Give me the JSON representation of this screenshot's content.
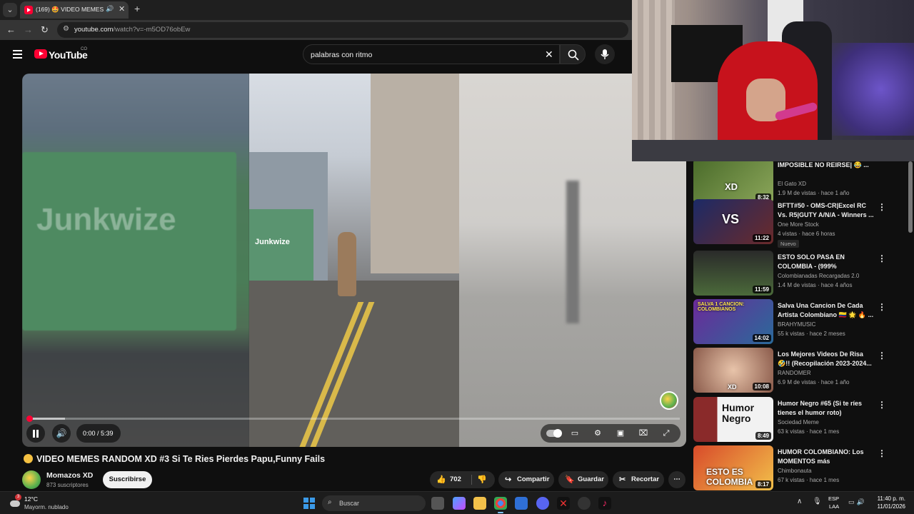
{
  "browser": {
    "tab_title": "(169) 🤩 VIDEO MEMES RA",
    "url_host": "youtube.com",
    "url_path": "/watch?v=-m5OD76obEw",
    "new_tab": "+"
  },
  "youtube": {
    "logo_text": "YouTube",
    "region": "CO",
    "search_value": "palabras con ritmo"
  },
  "player": {
    "time": "0:00 / 5:39",
    "progress_fraction": 0.0,
    "truck_text_left": "Junkwize",
    "truck_text_center": "Junkwize"
  },
  "video": {
    "title": "VIDEO MEMES RANDOM XD #3 Si Te Ries Pierdes Papu,Funny Fails",
    "channel": "Momazos XD",
    "subscribers": "873 suscriptores",
    "subscribe_label": "Suscribirse",
    "likes": "702",
    "share_label": "Compartir",
    "save_label": "Guardar",
    "clip_label": "Recortar"
  },
  "recommendations": [
    {
      "title": "IMPOSIBLE NO REIRSE| 😂 ...",
      "channel": "El Gato XD",
      "meta": "1.9 M de vistas · hace 1 año",
      "duration": "8:32",
      "thumb_text": "XD",
      "thumb_color": "#6b8c3a"
    },
    {
      "title": "BFTT#50 - OMS-CR|Excel RC Vs. R5|GUTY A/N/A - Winners ...",
      "channel": "One More Stock",
      "meta": "4 vistas · hace 6 horas",
      "badge": "Nuevo",
      "duration": "11:22",
      "thumb_text": "VS",
      "thumb_color": "#2a3a7a"
    },
    {
      "title": "ESTO SOLO PASA EN COLOMBIA - (999% imposible)...",
      "channel": "Colombianadas Recargadas 2.0",
      "meta": "1.4 M de vistas · hace 4 años",
      "duration": "11:59",
      "thumb_text": "",
      "thumb_color": "#3a3a3a"
    },
    {
      "title": "Salva Una Cancion De Cada Artista Colombiano 🇨🇴 🌟 🔥 ...",
      "channel": "BRAHYMUSIC",
      "meta": "55 k vistas · hace 2 meses",
      "duration": "14:02",
      "thumb_text": "SALVA 1 CANCION: COLOMBIANOS",
      "thumb_color": "#5a2a8a"
    },
    {
      "title": "Los Mejores Videos De Risa 🤣!! (Recopilación 2023-2024...",
      "channel": "RANDOMER",
      "meta": "6.9 M de vistas · hace 1 año",
      "duration": "10:08",
      "thumb_text": "XD",
      "thumb_color": "#c9a48a"
    },
    {
      "title": "Humor Negro #65 (Si te ríes tienes el humor roto)",
      "channel": "Sociedad Meme",
      "meta": "63 k vistas · hace 1 mes",
      "duration": "8:49",
      "thumb_text": "Humor Negro",
      "thumb_color": "#eeeeee"
    },
    {
      "title": "HUMOR COLOMBIANO: Los MOMENTOS más GRACIOSOS...",
      "channel": "Chimbonauta",
      "meta": "67 k vistas · hace 1 mes",
      "duration": "8:17",
      "thumb_text": "ESTO ES COLOMBIA",
      "thumb_color": "#c93a2a"
    }
  ],
  "taskbar": {
    "weather_temp": "12°C",
    "weather_cond": "Mayorm. nublado",
    "weather_badge": "3",
    "search_placeholder": "Buscar",
    "lang_line1": "ESP",
    "lang_line2": "LAA",
    "time": "11:40 p. m.",
    "date": "11/01/2026"
  },
  "colors": {
    "accent_red": "#ff0033",
    "page_bg": "#0f0f0f"
  }
}
